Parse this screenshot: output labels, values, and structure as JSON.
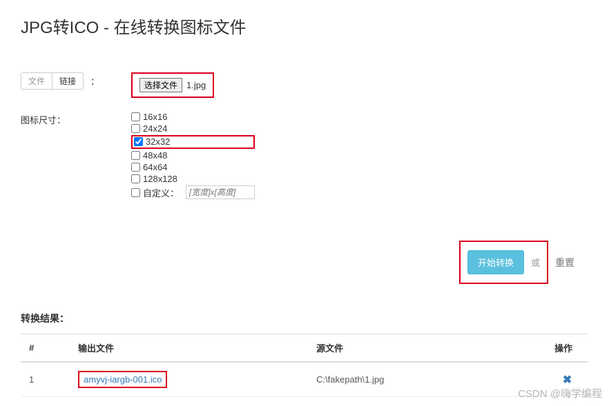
{
  "title": "JPG转ICO - 在线转换图标文件",
  "source": {
    "tabs": {
      "file": "文件",
      "link": "链接"
    },
    "colon": "：",
    "choose_btn": "选择文件",
    "file_name": "1.jpg"
  },
  "sizes": {
    "label": "图标尺寸：",
    "options": [
      {
        "label": "16x16",
        "checked": false
      },
      {
        "label": "24x24",
        "checked": false
      },
      {
        "label": "32x32",
        "checked": true
      },
      {
        "label": "48x48",
        "checked": false
      },
      {
        "label": "64x64",
        "checked": false
      },
      {
        "label": "128x128",
        "checked": false
      }
    ],
    "custom_label": "自定义：",
    "custom_placeholder": "[宽度]x[高度]"
  },
  "actions": {
    "convert": "开始转换",
    "or": "或",
    "reset": "重置"
  },
  "results": {
    "title": "转换结果：",
    "headers": {
      "index": "#",
      "output": "输出文件",
      "source": "源文件",
      "action": "操作"
    },
    "rows": [
      {
        "index": "1",
        "output": "amyvj-iargb-001.ico",
        "source": "C:\\fakepath\\1.jpg"
      }
    ]
  },
  "watermark": "CSDN @嗨学编程"
}
